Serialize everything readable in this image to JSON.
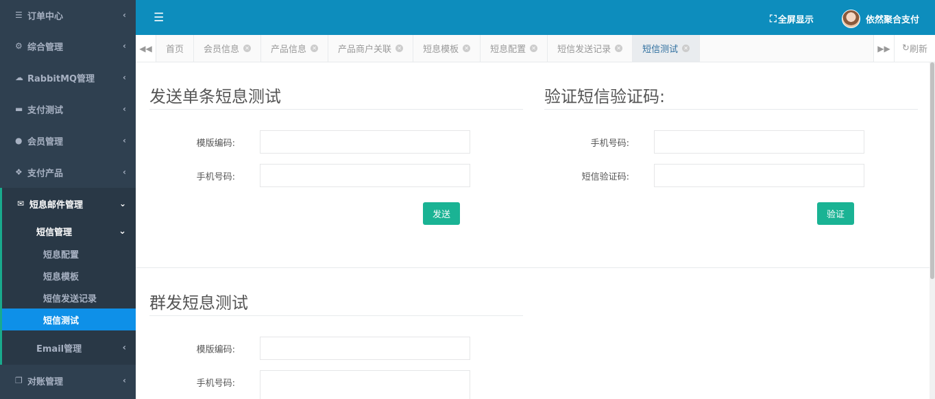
{
  "sidebar": {
    "top": {
      "icon": "menu-icon",
      "label": "订单中心"
    },
    "items": [
      {
        "icon": "cogs-icon",
        "label": "综合管理"
      },
      {
        "icon": "cloud-icon",
        "label": "RabbitMQ管理"
      },
      {
        "icon": "credit-card-icon",
        "label": "支付测试"
      },
      {
        "icon": "user-icon",
        "label": "会员管理"
      },
      {
        "icon": "cubes-icon",
        "label": "支付产品"
      }
    ],
    "open_group": {
      "icon": "envelope-icon",
      "label": "短息邮件管理",
      "sub": {
        "label": "短信管理",
        "items": [
          "短息配置",
          "短息模板",
          "短信发送记录",
          "短信测试"
        ],
        "active": "短信测试"
      },
      "email": {
        "label": "Email管理"
      }
    },
    "bottom": {
      "icon": "copy-icon",
      "label": "对账管理"
    }
  },
  "topbar": {
    "fullscreen_label": "全屏显示",
    "user_name": "依然聚合支付"
  },
  "tabs": {
    "items": [
      "首页",
      "会员信息",
      "产品信息",
      "产品商户关联",
      "短息模板",
      "短息配置",
      "短信发送记录",
      "短信测试"
    ],
    "active": "短信测试",
    "refresh_label": "刷新"
  },
  "single_send": {
    "title": "发送单条短息测试",
    "template_label": "模版编码:",
    "phone_label": "手机号码:",
    "template_value": "",
    "phone_value": "",
    "button": "发送"
  },
  "verify": {
    "title": "验证短信验证码:",
    "phone_label": "手机号码:",
    "code_label": "短信验证码:",
    "phone_value": "",
    "code_value": "",
    "button": "验证"
  },
  "group_send": {
    "title": "群发短息测试",
    "template_label": "模版编码:",
    "phone_label": "手机号码:",
    "template_value": "",
    "phone_value": ""
  },
  "colors": {
    "sidebar_bg": "#2f4050",
    "topbar_bg": "#0d8dbd",
    "active_menu": "#0e90e8",
    "button": "#1ab394"
  }
}
